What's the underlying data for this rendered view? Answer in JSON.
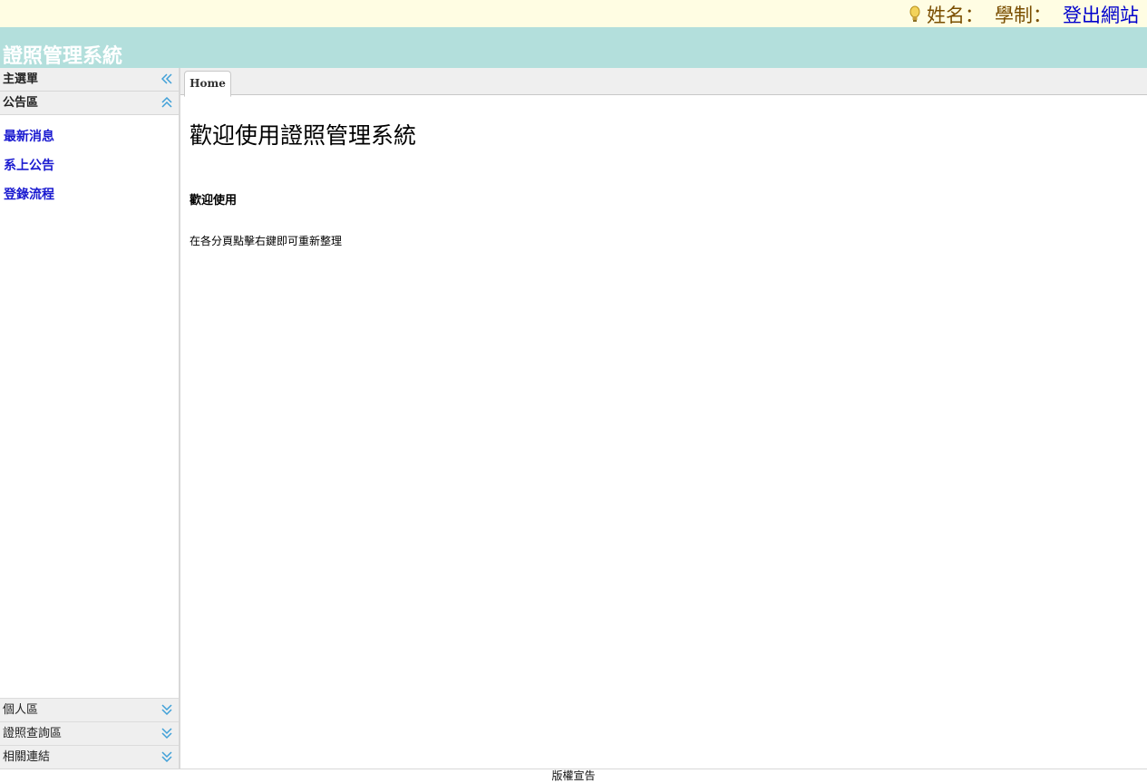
{
  "user_bar": {
    "name_label": "姓名：",
    "system_label": "學制：",
    "logout_label": "登出網站"
  },
  "header": {
    "title": "證照管理系統"
  },
  "sidebar": {
    "main_menu_label": "主選單",
    "announcement_panel": {
      "label": "公告區",
      "items": [
        {
          "label": "最新消息"
        },
        {
          "label": "系上公告"
        },
        {
          "label": "登錄流程"
        }
      ]
    },
    "collapsed_panels": [
      {
        "label": "個人區"
      },
      {
        "label": "證照查詢區"
      },
      {
        "label": "相關連結"
      }
    ]
  },
  "tabs": [
    {
      "label": "Home"
    }
  ],
  "content": {
    "heading": "歡迎使用證照管理系統",
    "subheading": "歡迎使用",
    "text": "在各分頁點擊右鍵即可重新整理"
  },
  "footer": {
    "text": "版權宣告"
  },
  "colors": {
    "user_bar_bg": "#fffde3",
    "banner_bg": "#b3dfdc",
    "link": "#1a1ad0",
    "chevron": "#3fa0d8"
  }
}
